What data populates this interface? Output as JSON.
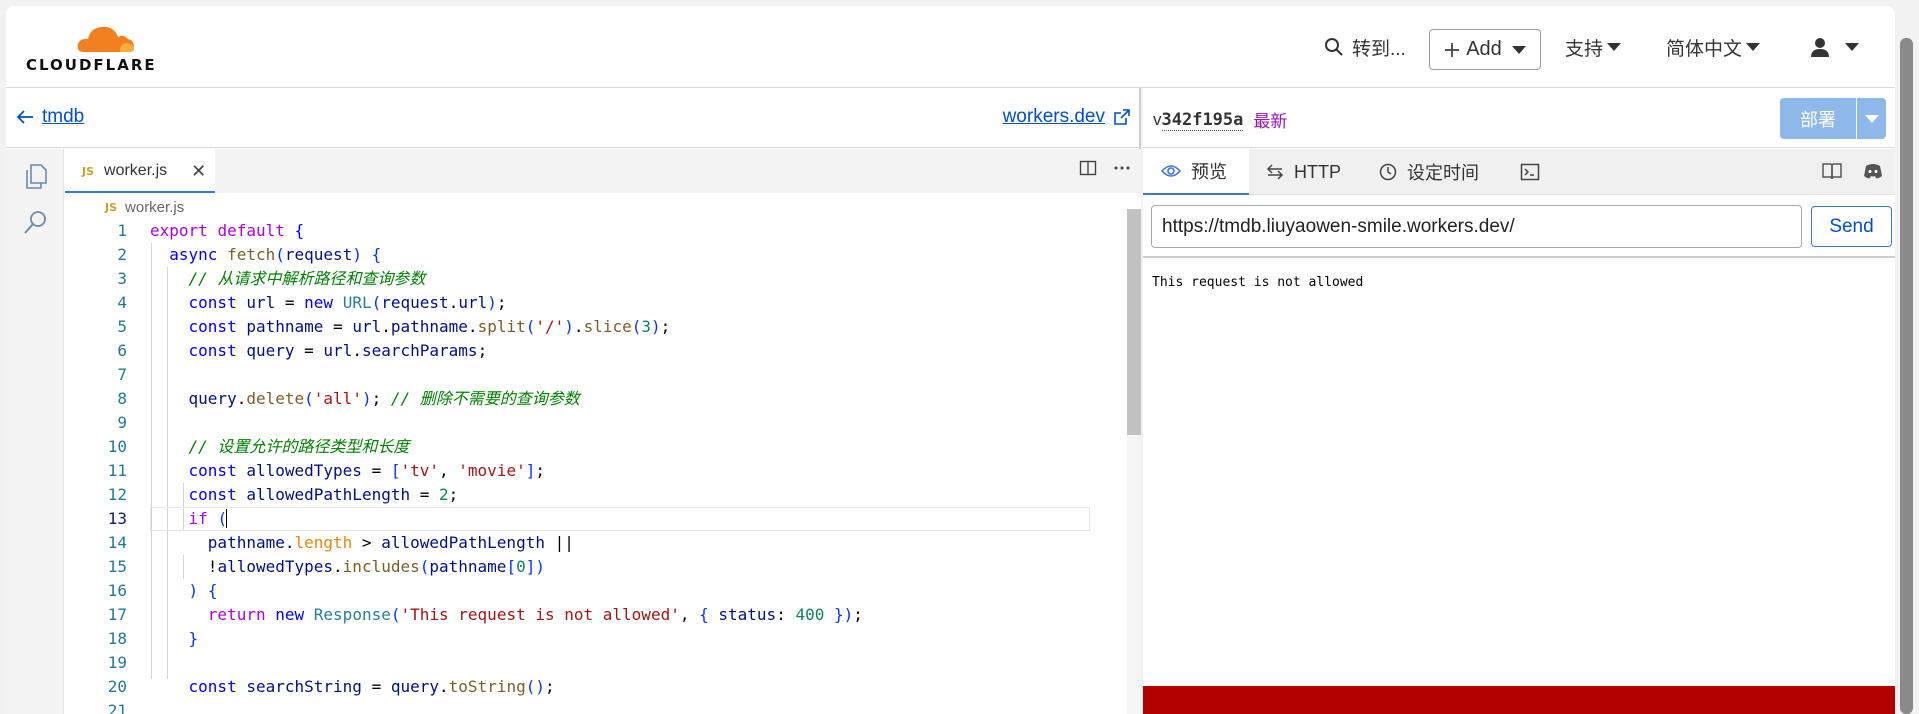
{
  "header": {
    "brand": "CLOUDFLARE",
    "goto_label": "转到...",
    "add_label": "Add",
    "support_label": "支持",
    "language_label": "简体中文"
  },
  "left": {
    "back_label": "tmdb",
    "workers_link": "workers.dev",
    "tab_badge": "JS",
    "tab_label": "worker.js",
    "breadcrumb_badge": "JS",
    "breadcrumb_file": "worker.js"
  },
  "code": {
    "line_numbers": [
      "1",
      "2",
      "3",
      "4",
      "5",
      "6",
      "7",
      "8",
      "9",
      "10",
      "11",
      "12",
      "13",
      "14",
      "15",
      "16",
      "17",
      "18",
      "19",
      "20",
      "21"
    ],
    "active_line": "13"
  },
  "right": {
    "version_prefix": "v",
    "version_hash": "342f195a",
    "version_tag": "最新",
    "deploy_label": "部署",
    "tabs": [
      "预览",
      "HTTP",
      "设定时间"
    ],
    "url_value": "https://tmdb.liuyaowen-smile.workers.dev/",
    "send_label": "Send",
    "response_text": "This request is not allowed"
  },
  "colors": {
    "brand_orange": "#f38020",
    "link_blue": "#0051c3",
    "deploy_blue": "#8fb8ea",
    "error_red": "#b30000",
    "tab_underline": "#3b73d9"
  },
  "icons": [
    "cloud-logo-icon",
    "search-icon",
    "plus-icon",
    "user-icon",
    "back-arrow-icon",
    "external-link-icon",
    "files-icon",
    "search-sidebar-icon",
    "split-editor-icon",
    "more-icon",
    "eye-icon",
    "swap-icon",
    "clock-icon",
    "terminal-icon",
    "book-icon",
    "discord-icon"
  ]
}
